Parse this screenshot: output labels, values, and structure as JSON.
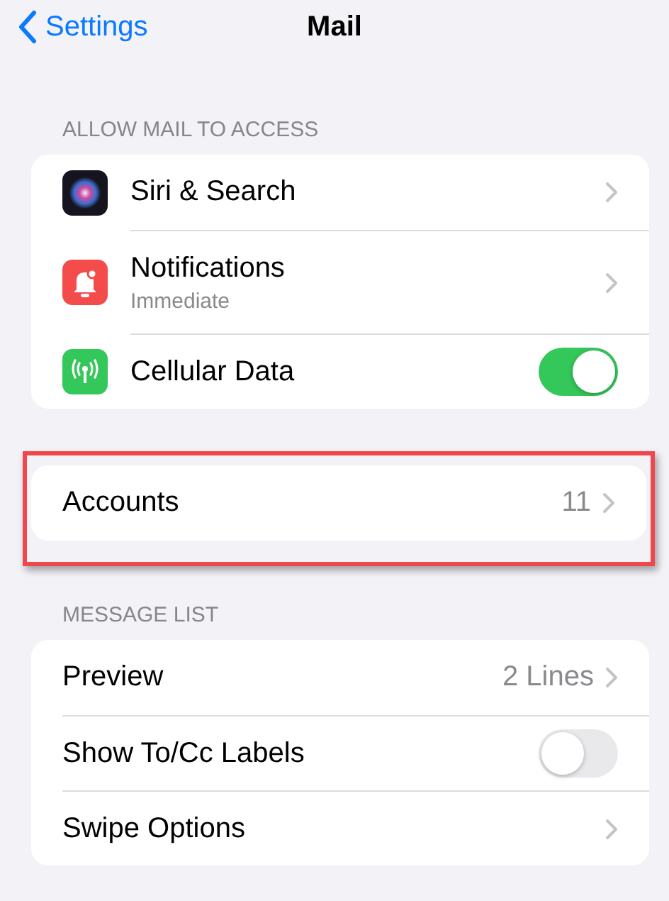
{
  "nav": {
    "back": "Settings",
    "title": "Mail"
  },
  "sections": [
    {
      "header": "ALLOW MAIL TO ACCESS",
      "icons": true,
      "highlighted": false,
      "rows": [
        {
          "kind": "link",
          "label": "Siri & Search"
        },
        {
          "kind": "link",
          "label": "Notifications",
          "subtitle": "Immediate"
        },
        {
          "kind": "toggle",
          "label": "Cellular Data",
          "on": true
        }
      ]
    },
    {
      "highlighted": true,
      "icons": false,
      "rows": [
        {
          "kind": "link",
          "label": "Accounts",
          "value": "11"
        }
      ]
    },
    {
      "header": "MESSAGE LIST",
      "icons": false,
      "highlighted": false,
      "rows": [
        {
          "kind": "link",
          "label": "Preview",
          "value": "2 Lines"
        },
        {
          "kind": "toggle",
          "label": "Show To/Cc Labels",
          "on": false
        },
        {
          "kind": "link",
          "label": "Swipe Options"
        }
      ]
    }
  ]
}
